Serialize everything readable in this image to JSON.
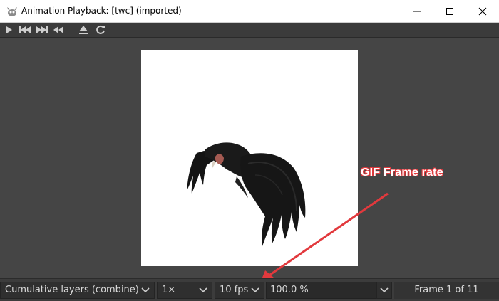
{
  "window": {
    "title": "Animation Playback: [twc] (imported)",
    "app_icon": "gimp-icon",
    "controls": [
      "minimize-icon",
      "maximize-icon",
      "close-icon"
    ]
  },
  "toolbar": {
    "buttons": [
      "play-icon",
      "rewind-to-start-icon",
      "skip-to-end-icon",
      "step-back-icon",
      "detach-icon",
      "reload-icon"
    ]
  },
  "statusbar": {
    "layer_mode": "Cumulative layers (combine)",
    "speed": "1×",
    "fps": "10 fps",
    "zoom": "100.0 %",
    "frame_indicator": "Frame 1 of 11"
  },
  "annotation": {
    "label": "GIF Frame rate",
    "color": "#e2393d"
  },
  "colors": {
    "canvas_bg": "#454545",
    "frame_bg": "#ffffff",
    "statusbar_bg": "#3c3c3c"
  }
}
